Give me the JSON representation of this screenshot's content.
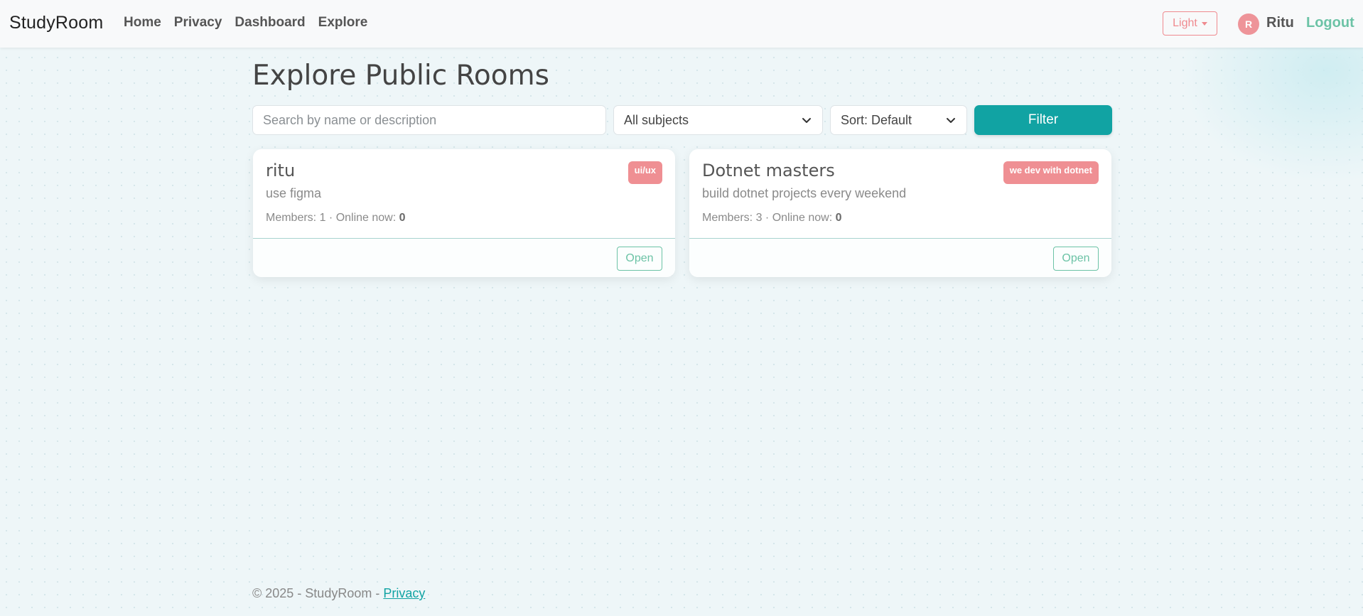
{
  "navbar": {
    "brand": "StudyRoom",
    "links": [
      "Home",
      "Privacy",
      "Dashboard",
      "Explore"
    ],
    "theme_label": "Light",
    "user_initial": "R",
    "user_name": "Ritu",
    "logout_label": "Logout"
  },
  "page": {
    "title": "Explore Public Rooms"
  },
  "filters": {
    "search_placeholder": "Search by name or description",
    "subject_selected": "All subjects",
    "sort_selected": "Sort: Default",
    "filter_label": "Filter"
  },
  "rooms": [
    {
      "name": "ritu",
      "description": "use figma",
      "subject": "ui/ux",
      "members_label": "Members: 1 · Online now:",
      "online_now": "0",
      "open_label": "Open"
    },
    {
      "name": "Dotnet masters",
      "description": "build dotnet projects every weekend",
      "subject": "we dev with dotnet",
      "members_label": "Members: 3 · Online now:",
      "online_now": "0",
      "open_label": "Open"
    }
  ],
  "footer": {
    "text": "© 2025 - StudyRoom - ",
    "privacy_link": "Privacy"
  },
  "colors": {
    "accent": "#11a3a3",
    "accent_green": "#6cc3a6",
    "badge": "#ef8f93"
  },
  "icons": {
    "select_arrow": "chevron-down-icon",
    "theme_caret": "caret-down-icon"
  }
}
